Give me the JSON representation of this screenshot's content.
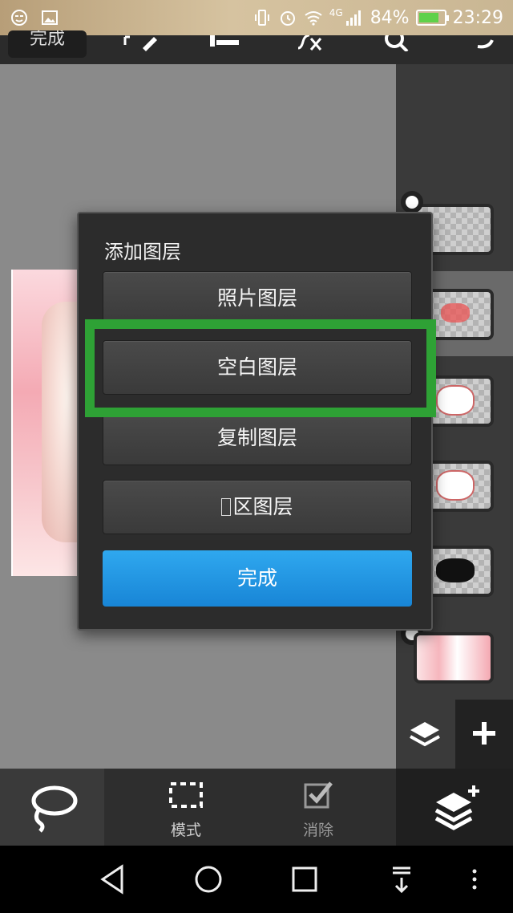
{
  "status_bar": {
    "network": "4G",
    "battery": "84%",
    "battery_level": 0.84,
    "time": "23:29",
    "icons": [
      "face-icon",
      "image-icon",
      "vibrate-icon",
      "alarm-icon",
      "wifi-icon",
      "signal-icon",
      "battery-icon"
    ]
  },
  "top_toolbar": {
    "done_label": "完成"
  },
  "dialog": {
    "title": "添加图层",
    "options": [
      {
        "label": "照片图层"
      },
      {
        "label": "空白图层"
      },
      {
        "label": "复制图层"
      },
      {
        "label": "区图层"
      }
    ],
    "done_label": "完成"
  },
  "bottom_toolbar": {
    "mode_label": "模式",
    "erase_label": "消除"
  },
  "colors": {
    "highlight": "#2ea135",
    "done_button": "#1e90e0",
    "dialog_bg": "#2c2c2c"
  }
}
